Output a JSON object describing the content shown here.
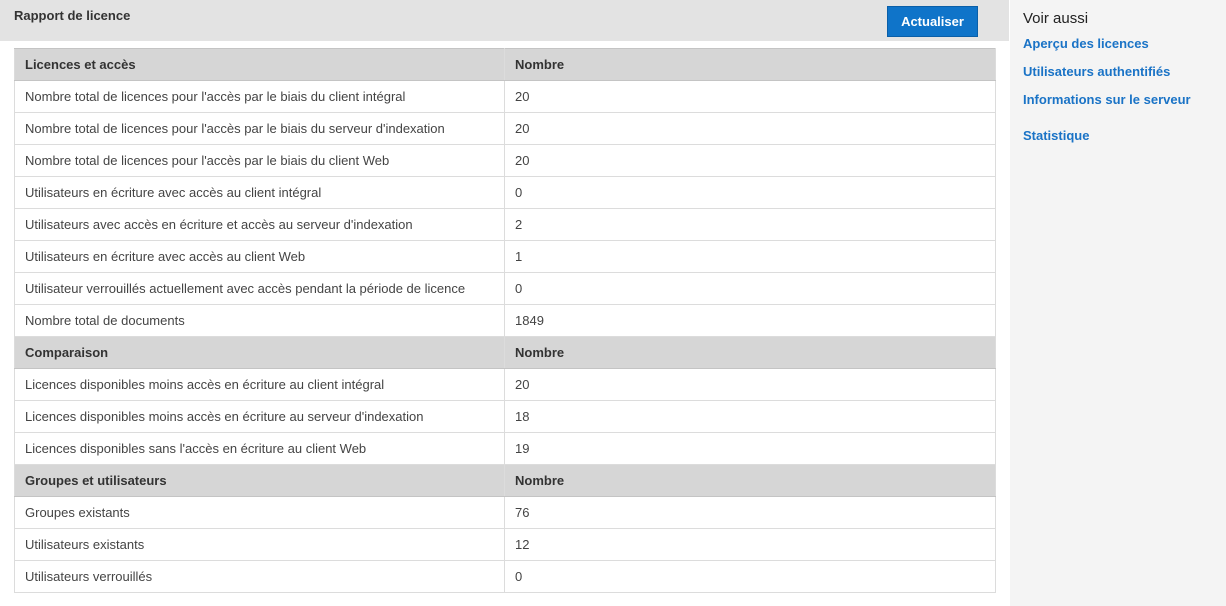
{
  "header": {
    "title": "Rapport de licence",
    "refresh_label": "Actualiser"
  },
  "sections": [
    {
      "heading": "Licences et accès",
      "value_heading": "Nombre",
      "rows": [
        {
          "label": "Nombre total de licences pour l'accès par le biais du client intégral",
          "value": "20"
        },
        {
          "label": "Nombre total de licences pour l'accès par le biais du serveur d'indexation",
          "value": "20"
        },
        {
          "label": "Nombre total de licences pour l'accès par le biais du client Web",
          "value": "20"
        },
        {
          "label": "Utilisateurs en écriture avec accès au client intégral",
          "value": "0"
        },
        {
          "label": "Utilisateurs avec accès en écriture et accès au serveur d'indexation",
          "value": "2"
        },
        {
          "label": "Utilisateurs en écriture avec accès au client Web",
          "value": "1"
        },
        {
          "label": "Utilisateur verrouillés actuellement avec accès pendant la période de licence",
          "value": "0"
        },
        {
          "label": "Nombre total de documents",
          "value": "1849"
        }
      ]
    },
    {
      "heading": "Comparaison",
      "value_heading": "Nombre",
      "rows": [
        {
          "label": "Licences disponibles moins accès en écriture au client intégral",
          "value": "20"
        },
        {
          "label": "Licences disponibles moins accès en écriture au serveur d'indexation",
          "value": "18"
        },
        {
          "label": "Licences disponibles sans l'accès en écriture au client Web",
          "value": "19"
        }
      ]
    },
    {
      "heading": "Groupes et utilisateurs",
      "value_heading": "Nombre",
      "rows": [
        {
          "label": "Groupes existants",
          "value": "76"
        },
        {
          "label": "Utilisateurs existants",
          "value": "12"
        },
        {
          "label": "Utilisateurs verrouillés",
          "value": "0"
        }
      ]
    }
  ],
  "sidebar": {
    "title": "Voir aussi",
    "links": [
      {
        "label": "Aperçu des licences"
      },
      {
        "label": "Utilisateurs authentifiés"
      },
      {
        "label": "Informations sur le serveur"
      },
      {
        "label": "Statistique"
      }
    ]
  },
  "colors": {
    "accent": "#0f74c9",
    "link": "#1a73c6",
    "header_bg": "#e3e3e3",
    "table_header_bg": "#d6d6d6",
    "sidebar_bg": "#f4f4f4"
  }
}
